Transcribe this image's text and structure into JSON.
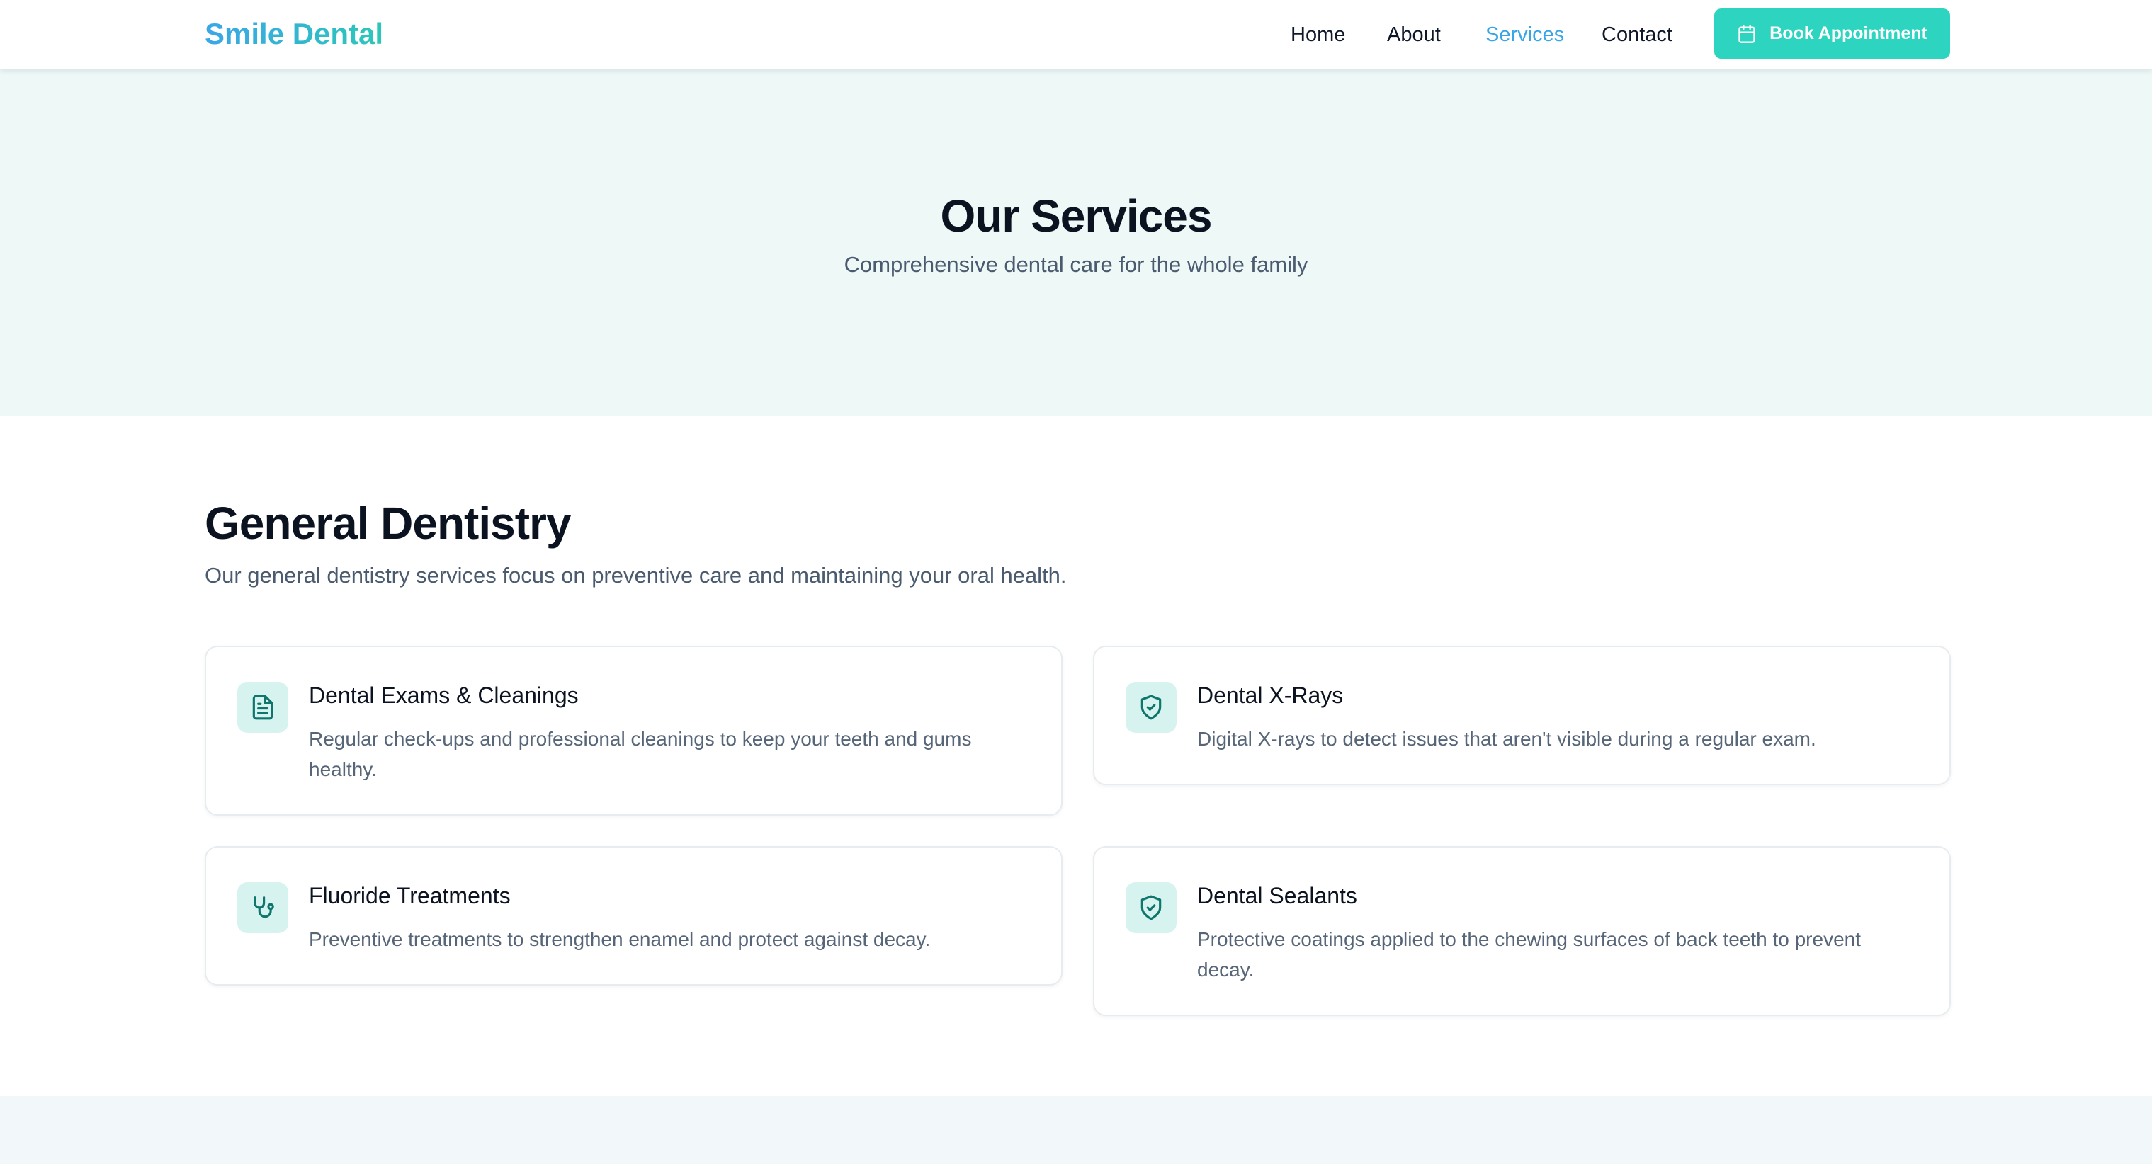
{
  "header": {
    "brand": "Smile Dental",
    "nav": [
      "Home",
      "About",
      "Services",
      "Contact"
    ],
    "active_nav": "Services",
    "book_button": "Book Appointment"
  },
  "hero": {
    "title": "Our Services",
    "subtitle": "Comprehensive dental care for the whole family"
  },
  "section": {
    "title": "General Dentistry",
    "description": "Our general dentistry services focus on preventive care and maintaining your oral health.",
    "services": [
      {
        "title": "Dental Exams & Cleanings",
        "description": "Regular check-ups and professional cleanings to keep your teeth and gums healthy.",
        "icon": "document-icon"
      },
      {
        "title": "Dental X-Rays",
        "description": "Digital X-rays to detect issues that aren't visible during a regular exam.",
        "icon": "shield-check-icon"
      },
      {
        "title": "Fluoride Treatments",
        "description": "Preventive treatments to strengthen enamel and protect against decay.",
        "icon": "stethoscope-icon"
      },
      {
        "title": "Dental Sealants",
        "description": "Protective coatings applied to the chewing surfaces of back teeth to prevent decay.",
        "icon": "shield-check-icon"
      }
    ]
  },
  "colors": {
    "accent": "#2dd4bf",
    "link_active": "#38a6e6",
    "hero_bg": "#edf8f7",
    "icon_bg": "#d7f3ef",
    "icon_stroke": "#0f766e"
  }
}
